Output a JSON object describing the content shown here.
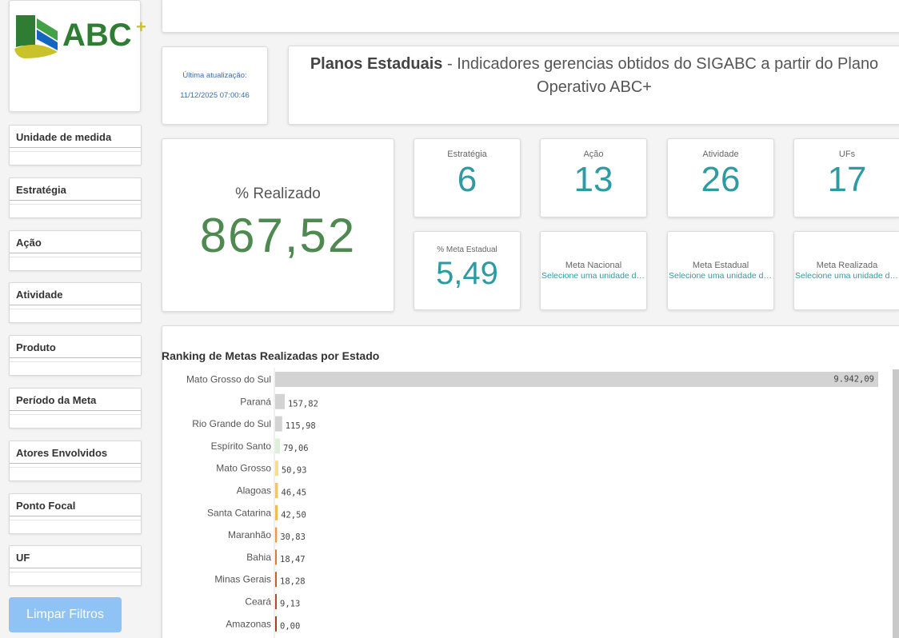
{
  "logo": {
    "text": "ABC",
    "plus": "+"
  },
  "filters": [
    "Unidade de medida",
    "Estratégia",
    "Ação",
    "Atividade",
    "Produto",
    "Período da Meta",
    "Atores Envolvidos",
    "Ponto Focal",
    "UF"
  ],
  "clear_button": "Limpar Filtros",
  "update": {
    "label": "Última atualização:",
    "value": "11/12/2025 07:00:46"
  },
  "title": {
    "bold": "Planos Estaduais",
    "rest": " - Indicadores gerencias obtidos do SIGABC a partir do Plano Operativo ABC+"
  },
  "kpi_main": {
    "label": "% Realizado",
    "value": "867,52"
  },
  "kpis": [
    {
      "label": "Estratégia",
      "value": "6"
    },
    {
      "label": "Ação",
      "value": "13"
    },
    {
      "label": "Atividade",
      "value": "26"
    },
    {
      "label": "UFs",
      "value": "17"
    }
  ],
  "kpi_meta": {
    "label": "% Meta Estadual",
    "value": "5,49"
  },
  "kpi_text": [
    {
      "label": "Meta Nacional",
      "value": "Selecione uma unidade de ..."
    },
    {
      "label": "Meta Estadual",
      "value": "Selecione uma unidade de ..."
    },
    {
      "label": "Meta Realizada",
      "value": "Selecione uma unidade de ..."
    }
  ],
  "chart_data": {
    "type": "bar",
    "orientation": "horizontal",
    "title": "Ranking de Metas Realizadas por Estado",
    "categories": [
      "Mato Grosso do Sul",
      "Paraná",
      "Rio Grande do Sul",
      "Espírito Santo",
      "Mato Grosso",
      "Alagoas",
      "Santa Catarina",
      "Maranhão",
      "Bahia",
      "Minas Gerais",
      "Ceará",
      "Amazonas"
    ],
    "values": [
      9942.09,
      157.82,
      115.98,
      79.06,
      50.93,
      46.45,
      42.5,
      30.83,
      18.47,
      18.28,
      9.13,
      0.0
    ],
    "labels": [
      "9.942,09",
      "157,82",
      "115,98",
      "79,06",
      "50,93",
      "46,45",
      "42,50",
      "30,83",
      "18,47",
      "18,28",
      "9,13",
      "0,00"
    ],
    "colors": [
      "#d3d3d3",
      "#d3d3d3",
      "#d3d3d3",
      "#dff0da",
      "#f7dc8c",
      "#f2c46a",
      "#f0b957",
      "#e99a45",
      "#d9793a",
      "#c8602e",
      "#b8492a",
      "#a83c26"
    ],
    "xlim": [
      0,
      9942.09
    ]
  }
}
